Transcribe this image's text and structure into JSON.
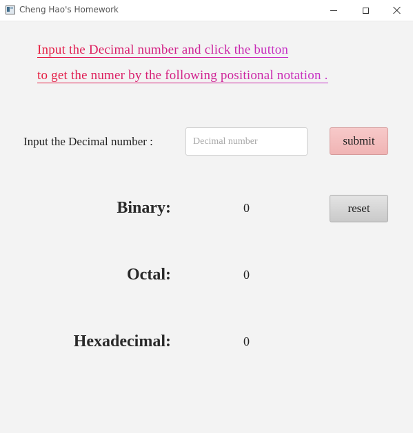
{
  "window": {
    "title": "Cheng Hao's Homework"
  },
  "instructions": {
    "line1": "Input the Decimal number and click the button ",
    "line2": "to get the numer by the following positional notation ."
  },
  "input": {
    "label": "Input the Decimal number :",
    "placeholder": "Decimal number",
    "value": ""
  },
  "buttons": {
    "submit": "submit",
    "reset": "reset"
  },
  "results": {
    "binary_label": "Binary:",
    "binary_value": "0",
    "octal_label": "Octal:",
    "octal_value": "0",
    "hex_label": "Hexadecimal:",
    "hex_value": "0"
  },
  "colors": {
    "background": "#f3f3f3",
    "instruction_gradient_start": "#e61c3c",
    "instruction_gradient_end": "#c531c9",
    "submit_button": "#f0b4b4",
    "reset_button": "#c9c9c9"
  },
  "icons": {
    "app": "app-window-icon",
    "minimize": "minimize-icon",
    "maximize": "maximize-icon",
    "close": "close-icon"
  }
}
